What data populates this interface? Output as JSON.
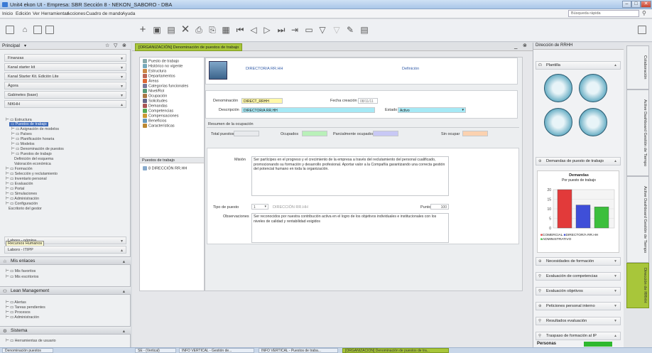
{
  "window": {
    "title": "Unit4 ekon UI - Empresa: SBR Sección 8 - NEKON_SABORO - DBA"
  },
  "menu": [
    "Inicio",
    "Edición",
    "Ver",
    "Herramientas",
    "Acciones",
    "Cuadro de mando",
    "Ayuda"
  ],
  "search": {
    "placeholder": "Búsqueda rápida"
  },
  "left": {
    "header": "Principal",
    "nav": [
      "Finanzas",
      "Kanal starter kit",
      "Kanal Starter Kit. Edición Lite",
      "Ágora",
      "Gabinetes (base)",
      "NIKHH"
    ],
    "tree": [
      "Estructura",
      "Puestos de trabajo",
      "Asignación de modelos",
      "Países",
      "Planificación horaria",
      "Modelos",
      "Denominación de puestos",
      "Puestos de trabajo",
      "Definición del esquema",
      "Valoración económica",
      "Formación",
      "Selección y reclutamiento",
      "Inventario personal",
      "Evaluación",
      "Portal",
      "Simulaciones",
      "Administración",
      "Configuración",
      "Escritorio del gestor"
    ],
    "combo1": "Laboro - nómina",
    "combo_tip": "Recursos Humanos",
    "combo2": "Laboro - ITIPP",
    "sec_enlaces": "Mis enlaces",
    "enlaces": [
      "Mis favoritos",
      "Mis escritorios"
    ],
    "sec_lean": "Lean Management",
    "lean": [
      "Alertas",
      "Tareas pendientes",
      "Procesos",
      "Administración"
    ],
    "sec_sistema": "Sistema",
    "sistema": [
      "Herramientas de usuario"
    ]
  },
  "tab": {
    "label": "[ORGANIZACIÓN] Denominación de puestos de trabajo"
  },
  "tree2": [
    "Puesto de trabajo",
    "Histórico no vigente",
    "Estructura",
    "Departamentos",
    "Áreas",
    "Categorías funcionales",
    "Nivel/Rol",
    "Ocupación",
    "Solicitudes",
    "Demandas",
    "Competencias",
    "Compensaciones",
    "Beneficios",
    "Características"
  ],
  "puestos": {
    "header": "Puestos de trabajo",
    "item": "8 DIRECCIÓN RR.HH"
  },
  "form": {
    "top_title": "DIRECTOR/A RR.HH",
    "definicion": "Definición",
    "denominacion_lbl": "Denominación",
    "denominacion_val": "DIRECT_RRHH",
    "fecha_lbl": "Fecha creación",
    "fecha_val": "08/11/11",
    "descripcion_lbl": "Descripción",
    "descripcion_val": "DIRECTOR/A RR.HH",
    "estado_lbl": "Estado",
    "estado_val": "Activo",
    "resumen": "Resumen de la ocupación",
    "total": "Total puestos",
    "ocupados": "Ocupados",
    "parcial": "Parcialmente ocupados",
    "sin": "Sin ocupar",
    "mision_lbl": "Misión",
    "mision_val": "Ser partícipes en el progreso y el crecimiento de la empresa a través del reclutamiento del personal cualificado, promocionando su formación y desarrollo profesional. Aportar valor a la Compañía garantizando una correcta gestión del potencial humano en toda la organización.",
    "tipo_lbl": "Tipo de puesto",
    "tipo_val": "1",
    "tipo_desc": "DIRECCIÓN RR.HH",
    "puntos_lbl": "Puntos",
    "puntos_val": "100",
    "obs_lbl": "Observaciones",
    "obs_val": "Ser reconocidos por nuestra contribución activa en el logro de los objetivos individuales e institucionales con los niveles de calidad y rentabilidad exigidos"
  },
  "right": {
    "header": "Dirección de RRHH",
    "plantilla": "Plantilla",
    "demandas": "Demandas de puesto de trabajo",
    "chart_title": "Demandas",
    "chart_sub": "Por puesto de trabajo",
    "legend": [
      "COMERCIAL",
      "DIRECTOR/A RR.HH",
      "ADMINISTRATIVO"
    ],
    "sections": [
      "Necesidades de formación",
      "Evaluación de competencias",
      "Evaluación objetivos",
      "Peticiones personal interno",
      "Resultados evaluación",
      "Traspaso de formación al IP"
    ],
    "personas": "Personas"
  },
  "vtabs": [
    "Colaboración",
    "Active Dashboard Gestión de Tiempo",
    "Active Dashboard Gestión de Tiempo",
    "Dirección de RRHH"
  ],
  "status": [
    "Denominación puestos",
    "SE - (Vertical)",
    "INFO VERTICAL - Gestión de...",
    "INFO VERTICAL - Puestos de traba...",
    "[ORGANIZACIÓN] Denominación de puestos de tra..."
  ],
  "chart_data": {
    "type": "bar",
    "title": "Demandas",
    "subtitle": "Por puesto de trabajo",
    "categories": [
      "COMERCIAL",
      "DIRECTOR/A RR.HH",
      "ADMINISTRATIVO"
    ],
    "values": [
      20,
      12,
      11
    ],
    "ylim": [
      0,
      20
    ],
    "colors": [
      "#e23a3a",
      "#3f4fd8",
      "#3cbf3c"
    ]
  }
}
